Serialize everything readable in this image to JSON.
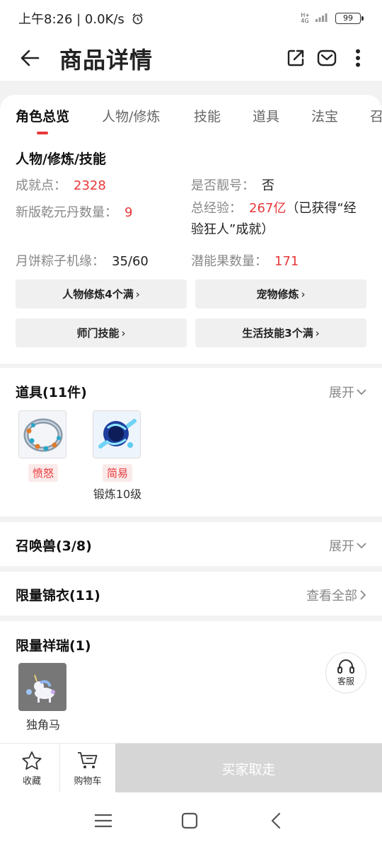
{
  "status_bar": {
    "time": "上午8:26 | 0.0K/s",
    "net_type_top": "H+",
    "net_type_bottom": "4G",
    "battery": "99"
  },
  "app_bar": {
    "title": "商品详情"
  },
  "tabs": [
    "角色总览",
    "人物/修炼",
    "技能",
    "道具",
    "法宝",
    "召"
  ],
  "overview": {
    "heading": "人物/修炼/技能",
    "achievement_label": "成就点：",
    "achievement_value": "2328",
    "pretty_id_label": "是否靓号：",
    "pretty_id_value": "否",
    "dan_label": "新版乾元丹数量：",
    "dan_value": "9",
    "exp_label": "总经验：",
    "exp_value": "267亿",
    "exp_note": "（已获得“经验狂人”成就）",
    "mooncake_label": "月饼粽子机缘：",
    "mooncake_value": "35/60",
    "potential_label": "潜能果数量：",
    "potential_value": "171",
    "buttons": [
      "人物修炼4个满",
      "宠物修炼",
      "师门技能",
      "生活技能3个满"
    ]
  },
  "items_section": {
    "title": "道具(11件)",
    "expand": "展开",
    "items": [
      {
        "tag": "愤怒",
        "sub": ""
      },
      {
        "tag": "简易",
        "sub": "锻炼10级"
      }
    ]
  },
  "pets_section": {
    "title": "召唤兽(3/8)",
    "expand": "展开"
  },
  "outfit_section": {
    "title": "限量锦衣(11)",
    "action": "查看全部"
  },
  "auspicious_section": {
    "title": "限量祥瑞(1)",
    "items": [
      {
        "name": "独角马"
      }
    ]
  },
  "service": {
    "label": "客服"
  },
  "bottom_bar": {
    "favorite": "收藏",
    "cart": "购物车",
    "buy": "买家取走"
  },
  "colors": {
    "accent_red": "#e8383a",
    "disabled_gray": "#d6d6d6"
  }
}
